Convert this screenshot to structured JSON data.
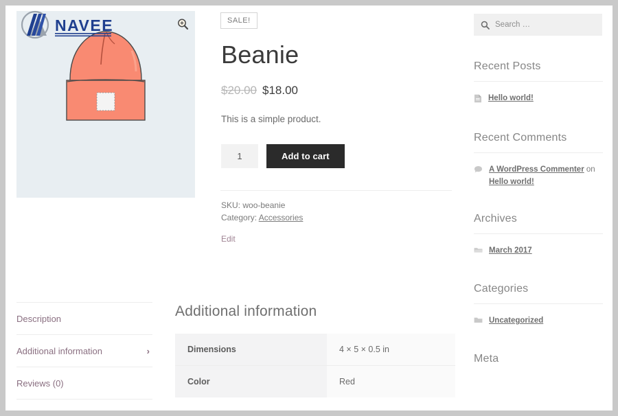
{
  "gallery": {
    "zoom_icon": "magnifier-plus-icon",
    "image_alt": "Beanie",
    "logo_text": "NAVEE"
  },
  "product": {
    "sale_badge": "SALE!",
    "title": "Beanie",
    "price_old": "$20.00",
    "price_new": "$18.00",
    "short_description": "This is a simple product.",
    "quantity": "1",
    "quantity_placeholder": "1",
    "add_to_cart_label": "Add to cart",
    "sku_label": "SKU:",
    "sku_value": "woo-beanie",
    "category_label": "Category:",
    "category_value": "Accessories",
    "edit_label": "Edit"
  },
  "tabs": [
    {
      "label": "Description",
      "active": false
    },
    {
      "label": "Additional information",
      "active": true
    },
    {
      "label": "Reviews (0)",
      "active": false
    }
  ],
  "tab_chevron": "›",
  "panel": {
    "heading": "Additional information",
    "rows": [
      {
        "label": "Dimensions",
        "value": "4 × 5 × 0.5 in"
      },
      {
        "label": "Color",
        "value": "Red"
      }
    ]
  },
  "sidebar": {
    "search": {
      "placeholder": "Search …",
      "value": "",
      "icon": "search-icon"
    },
    "widgets": [
      {
        "title": "Recent Posts",
        "items": [
          {
            "icon": "document-icon",
            "link": "Hello world!",
            "suffix": "",
            "link2": ""
          }
        ]
      },
      {
        "title": "Recent Comments",
        "items": [
          {
            "icon": "comment-icon",
            "link": "A WordPress Commenter",
            "suffix": " on ",
            "link2": "Hello world!"
          }
        ]
      },
      {
        "title": "Archives",
        "items": [
          {
            "icon": "folder-open-icon",
            "link": "March 2017",
            "suffix": "",
            "link2": ""
          }
        ]
      },
      {
        "title": "Categories",
        "items": [
          {
            "icon": "folder-icon",
            "link": "Uncategorized",
            "suffix": "",
            "link2": ""
          }
        ]
      },
      {
        "title": "Meta",
        "items": []
      }
    ]
  },
  "colors": {
    "accent_dark": "#2b2b2b",
    "link_mauve": "#9f8393",
    "tab_text": "#8a6f81",
    "gallery_bg": "#e8eef2",
    "beanie": "#f98a72",
    "logo_blue": "#1f3f8f"
  }
}
